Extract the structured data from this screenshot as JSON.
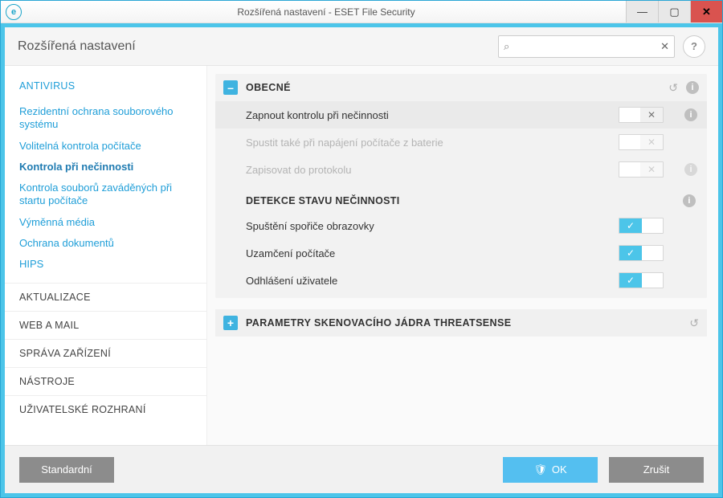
{
  "window": {
    "title": "Rozšířená nastavení - ESET File Security"
  },
  "topbar": {
    "heading": "Rozšířená nastavení",
    "search_placeholder": ""
  },
  "sidebar": {
    "sections": [
      {
        "label": "ANTIVIRUS",
        "expanded": true,
        "items": [
          {
            "label": "Rezidentní ochrana souborového systému"
          },
          {
            "label": "Volitelná kontrola počítače"
          },
          {
            "label": "Kontrola při nečinnosti",
            "active": true
          },
          {
            "label": "Kontrola souborů zaváděných při startu počítače"
          },
          {
            "label": "Výměnná média"
          },
          {
            "label": "Ochrana dokumentů"
          },
          {
            "label": "HIPS"
          }
        ]
      },
      {
        "label": "AKTUALIZACE"
      },
      {
        "label": "WEB A MAIL"
      },
      {
        "label": "SPRÁVA ZAŘÍZENÍ"
      },
      {
        "label": "NÁSTROJE"
      },
      {
        "label": "UŽIVATELSKÉ ROZHRANÍ"
      }
    ]
  },
  "content": {
    "general": {
      "title": "OBECNÉ",
      "rows": [
        {
          "label": "Zapnout kontrolu při nečinnosti",
          "state": "off",
          "disabled": false
        },
        {
          "label": "Spustit také při napájení počítače z baterie",
          "state": "off",
          "disabled": true
        },
        {
          "label": "Zapisovat do protokolu",
          "state": "off",
          "disabled": true
        }
      ],
      "idle": {
        "title": "DETEKCE STAVU NEČINNOSTI",
        "rows": [
          {
            "label": "Spuštění spořiče obrazovky",
            "state": "on"
          },
          {
            "label": "Uzamčení počítače",
            "state": "on"
          },
          {
            "label": "Odhlášení uživatele",
            "state": "on"
          }
        ]
      }
    },
    "threatsense": {
      "title": "PARAMETRY SKENOVACÍHO JÁDRA THREATSENSE"
    }
  },
  "footer": {
    "default_btn": "Standardní",
    "ok_btn": "OK",
    "cancel_btn": "Zrušit"
  },
  "glyphs": {
    "minus": "–",
    "plus": "+",
    "check": "✓",
    "x": "✕",
    "undo": "↺",
    "info": "i",
    "search": "⌕",
    "help": "?",
    "shield": "🛡"
  }
}
